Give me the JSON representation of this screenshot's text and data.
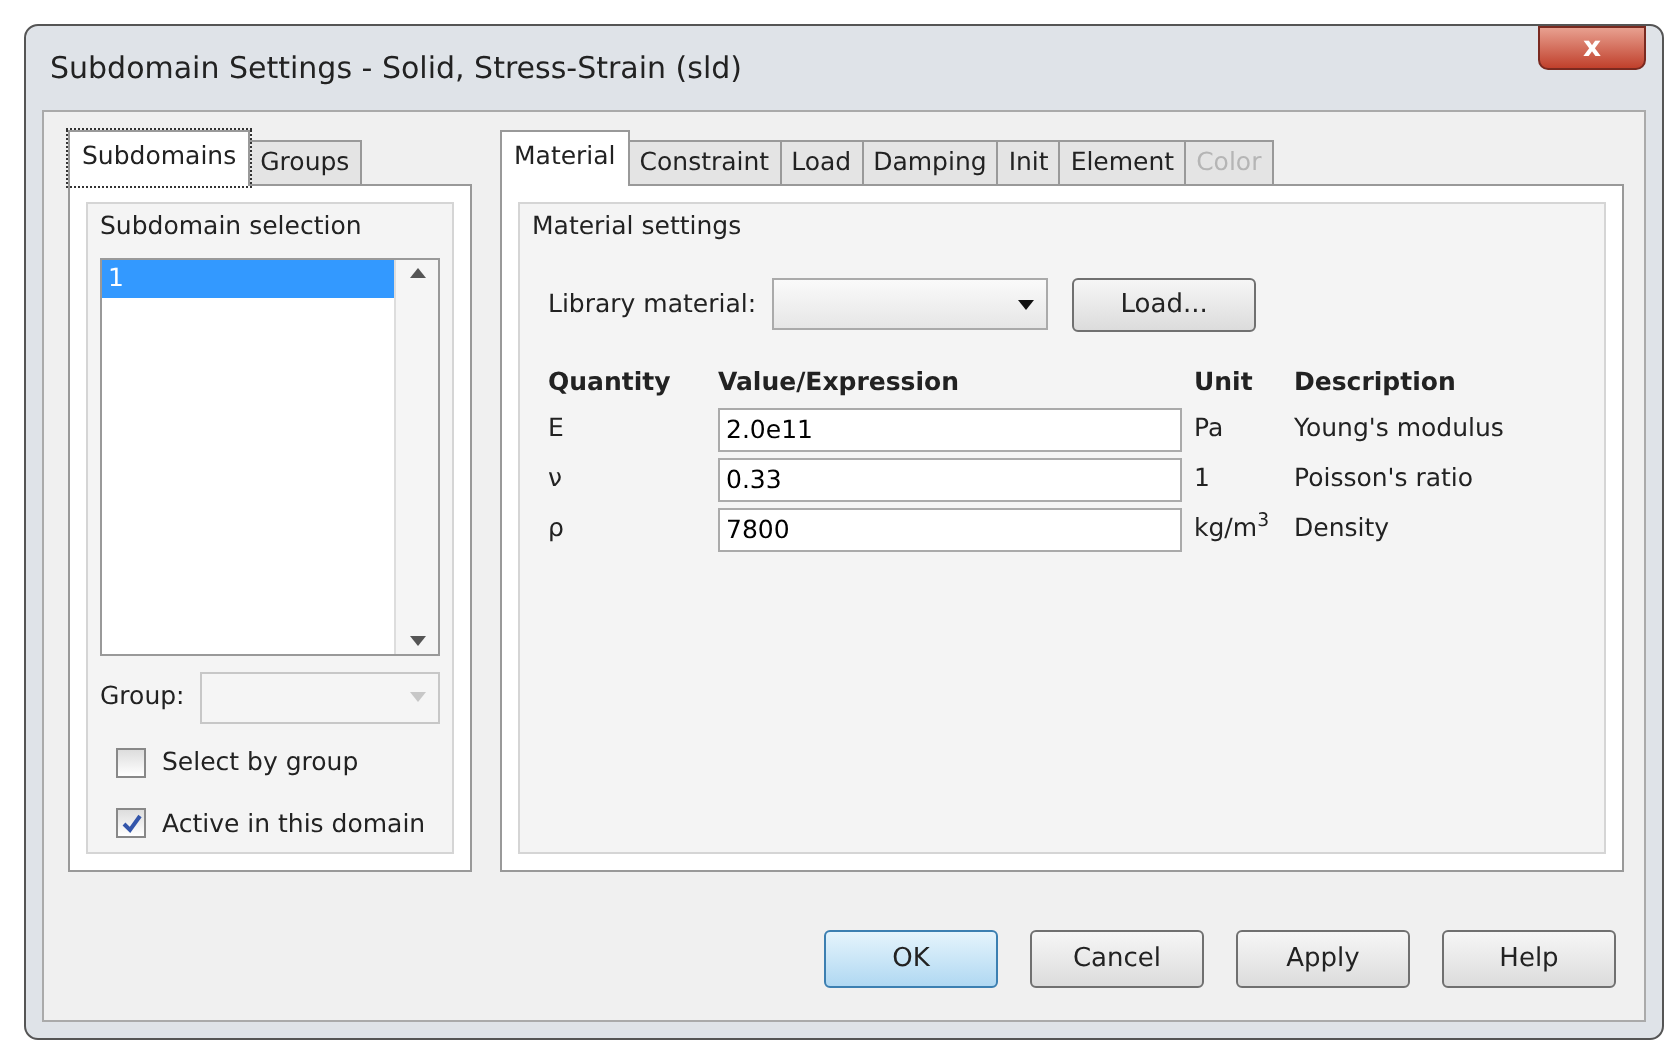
{
  "window": {
    "title": "Subdomain Settings - Solid, Stress-Strain (sld)",
    "close": "x"
  },
  "left_tabs": [
    {
      "label": "Subdomains",
      "selected": true
    },
    {
      "label": "Groups",
      "selected": false
    }
  ],
  "subdomain_selection": {
    "title": "Subdomain selection",
    "items": [
      {
        "label": "1",
        "selected": true
      }
    ],
    "group_label": "Group:",
    "group_disabled": true,
    "checkboxes": [
      {
        "label": "Select by group",
        "checked": false
      },
      {
        "label": "Active in this domain",
        "checked": true
      }
    ]
  },
  "right_tabs": [
    {
      "label": "Material",
      "selected": true,
      "disabled": false
    },
    {
      "label": "Constraint",
      "selected": false,
      "disabled": false
    },
    {
      "label": "Load",
      "selected": false,
      "disabled": false
    },
    {
      "label": "Damping",
      "selected": false,
      "disabled": false
    },
    {
      "label": "Init",
      "selected": false,
      "disabled": false
    },
    {
      "label": "Element",
      "selected": false,
      "disabled": false
    },
    {
      "label": "Color",
      "selected": false,
      "disabled": true
    }
  ],
  "material_settings": {
    "title": "Material settings",
    "library_label": "Library material:",
    "load_button": "Load...",
    "columns": [
      "Quantity",
      "Value/Expression",
      "Unit",
      "Description"
    ],
    "rows": [
      {
        "quantity": "E",
        "value": "2.0e11",
        "unit": "Pa",
        "description": "Young's modulus"
      },
      {
        "quantity": "ν",
        "value": "0.33",
        "unit": "1",
        "description": "Poisson's ratio"
      },
      {
        "quantity": "ρ",
        "value": "7800",
        "unit": "kg/m$^{3}$",
        "description": "Density"
      }
    ]
  },
  "buttons": [
    {
      "label": "OK",
      "default": true
    },
    {
      "label": "Cancel",
      "default": false
    },
    {
      "label": "Apply",
      "default": false
    },
    {
      "label": "Help",
      "default": false
    }
  ]
}
